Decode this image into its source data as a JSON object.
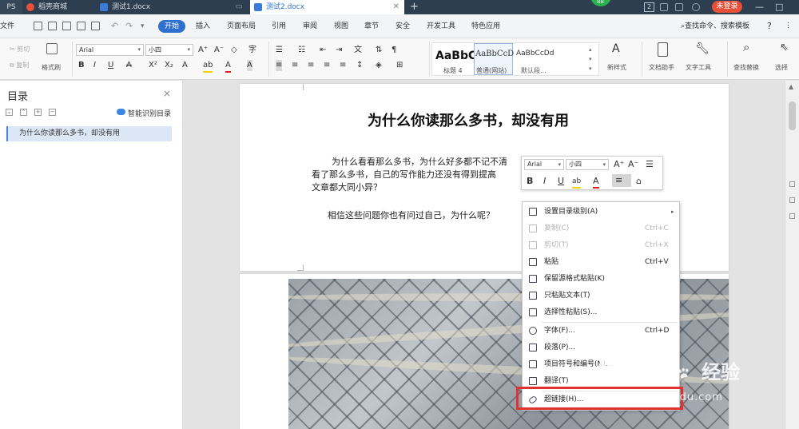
{
  "titlebar": {
    "tabs": [
      {
        "label": "PS"
      },
      {
        "label": "稻壳商城"
      },
      {
        "label": "测试1.docx"
      },
      {
        "label": "测试2.docx"
      }
    ],
    "new_tab": "+",
    "badge_count": "88",
    "counter": "2",
    "login": "未登录",
    "minimize": "—",
    "maximize": "□"
  },
  "menubar": {
    "file": "文件",
    "items": [
      "开始",
      "插入",
      "页面布局",
      "引用",
      "审阅",
      "视图",
      "章节",
      "安全",
      "开发工具",
      "特色应用"
    ],
    "search": "查找命令、搜索模板",
    "help": "?"
  },
  "ribbon": {
    "cut": "剪切",
    "copy": "复制",
    "format_painter": "格式刷",
    "font_name": "Arial",
    "font_size": "小四",
    "styles": [
      {
        "sample": "AaBbC",
        "name": "标题 4"
      },
      {
        "sample": "AaBbCcD",
        "name": "普通(网站)"
      },
      {
        "sample": "AaBbCcDd",
        "name": "默认段..."
      }
    ],
    "new_style": "新样式",
    "doc_assistant": "文档助手",
    "text_tools": "文字工具",
    "find_replace": "查找替换",
    "select": "选择"
  },
  "toc": {
    "title": "目录",
    "close": "×",
    "smart_toc": "智能识别目录",
    "items": [
      "为什么你读那么多书，却没有用"
    ]
  },
  "document": {
    "title": "为什么你读那么多书，却没有用",
    "para1_line1": "为什么看看那么多书，为什么好多都不记不清",
    "para1_line2": "看了那么多书，自己的写作能力还没有得到提高",
    "para1_line3": "文章都大同小异？",
    "para2": "相信这些问题你也有问过自己，为什么呢？"
  },
  "minibar": {
    "font_name": "Arial",
    "font_size": "小四",
    "bold": "B",
    "italic": "I",
    "underline": "U"
  },
  "context_menu": {
    "items": [
      {
        "label": "设置目录级别(A)",
        "shortcut": "",
        "disabled": false,
        "submenu": true
      },
      {
        "label": "复制(C)",
        "shortcut": "Ctrl+C",
        "disabled": true
      },
      {
        "label": "剪切(T)",
        "shortcut": "Ctrl+X",
        "disabled": true
      },
      {
        "label": "粘贴",
        "shortcut": "Ctrl+V",
        "disabled": false
      },
      {
        "label": "保留源格式粘贴(K)",
        "shortcut": "",
        "disabled": false
      },
      {
        "label": "只粘贴文本(T)",
        "shortcut": "",
        "disabled": false
      },
      {
        "label": "选择性粘贴(S)...",
        "shortcut": "",
        "disabled": false
      },
      {
        "label": "字体(F)...",
        "shortcut": "Ctrl+D",
        "disabled": false
      },
      {
        "label": "段落(P)...",
        "shortcut": "",
        "disabled": false
      },
      {
        "label": "项目符号和编号(N)...",
        "shortcut": "",
        "disabled": false
      },
      {
        "label": "翻译(T)",
        "shortcut": "",
        "disabled": false
      },
      {
        "label": "超链接(H)...",
        "shortcut": "",
        "disabled": false
      }
    ]
  },
  "watermark": {
    "logo": "Bai",
    "logo_cn": "经验",
    "url": "jingyan.baidu.com"
  },
  "colors": {
    "accent": "#2f6fcf",
    "titlebar": "#2d3e50",
    "highlight": "#e03030",
    "login": "#e8503a"
  }
}
